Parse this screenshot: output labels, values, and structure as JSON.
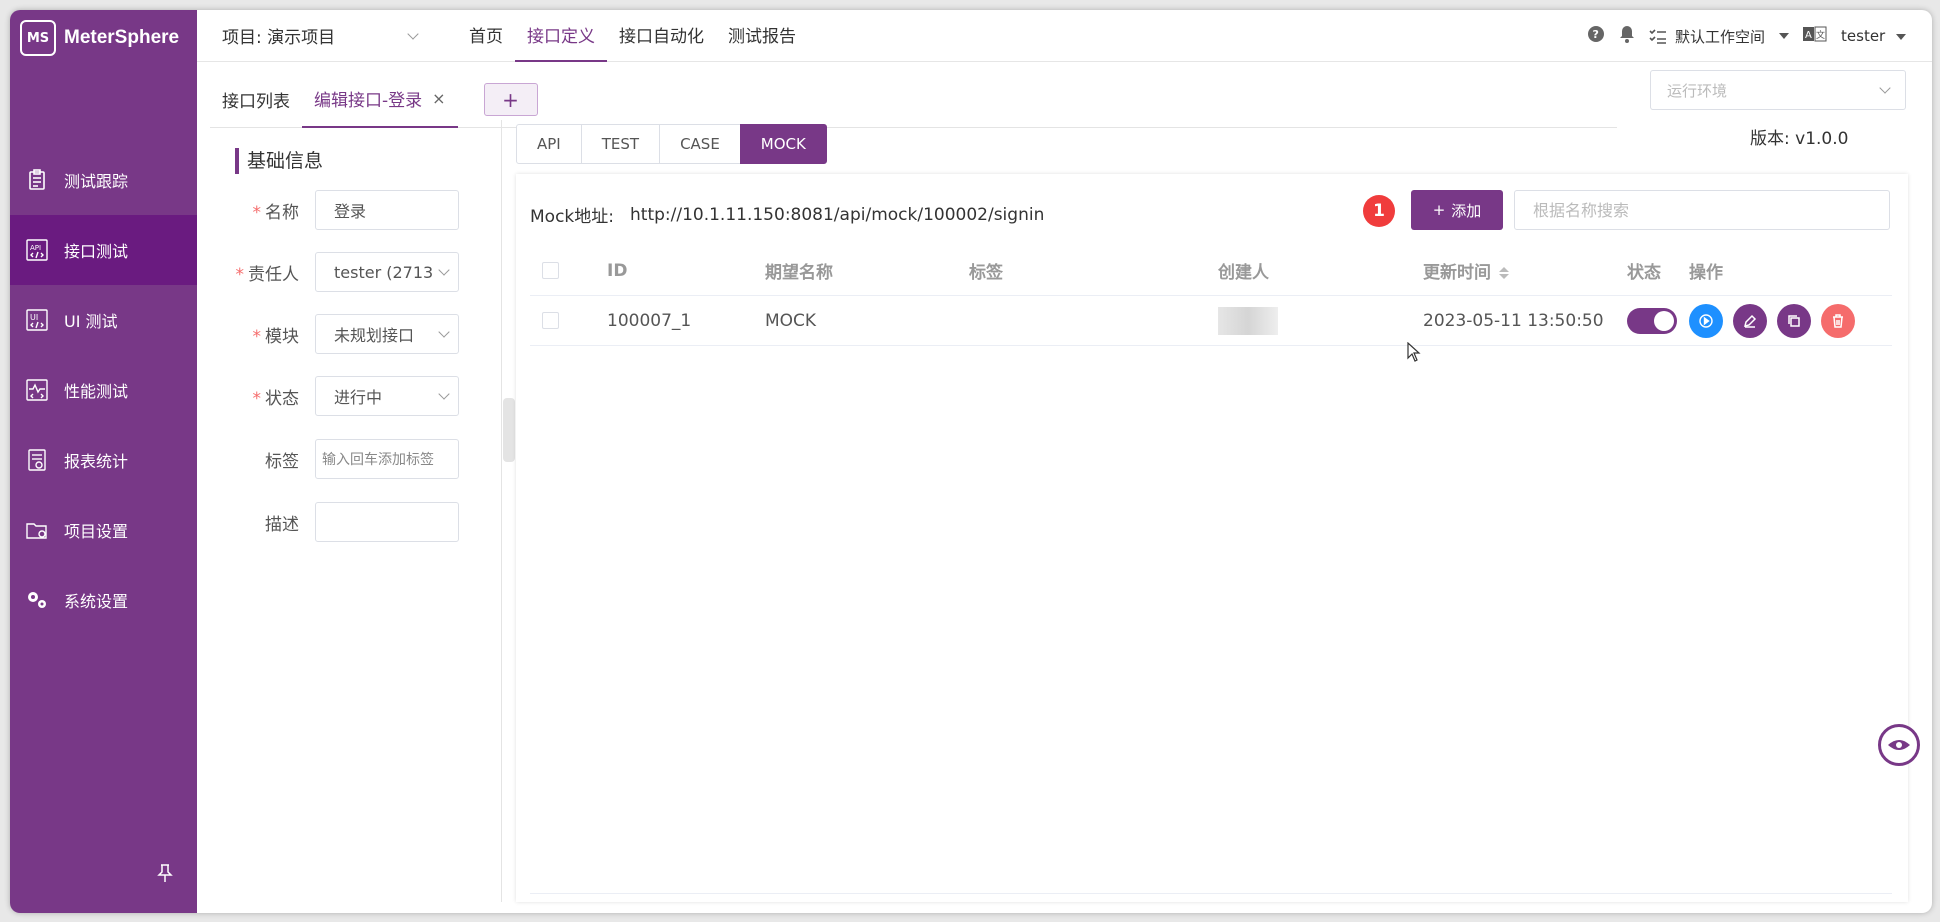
{
  "app": {
    "name": "MeterSphere",
    "logo_mark": "MS"
  },
  "sidebar": {
    "items": [
      {
        "label": "测试跟踪",
        "icon": "clipboard-icon"
      },
      {
        "label": "接口测试",
        "icon": "api-icon",
        "active": true
      },
      {
        "label": "UI 测试",
        "icon": "ui-icon"
      },
      {
        "label": "性能测试",
        "icon": "performance-icon"
      },
      {
        "label": "报表统计",
        "icon": "report-icon"
      },
      {
        "label": "项目设置",
        "icon": "folder-settings-icon"
      },
      {
        "label": "系统设置",
        "icon": "gears-icon"
      }
    ],
    "pin_icon": "pin-icon"
  },
  "header": {
    "project": "项目: 演示项目",
    "menu": [
      "首页",
      "接口定义",
      "接口自动化",
      "测试报告"
    ],
    "active_menu": "接口定义",
    "workspace": "默认工作空间",
    "user": "tester"
  },
  "tabs": {
    "list": "接口列表",
    "edit": "编辑接口-登录",
    "close": "×",
    "add": "+"
  },
  "env_select": {
    "placeholder": "运行环境"
  },
  "version": "版本: v1.0.0",
  "basic_info": {
    "title": "基础信息",
    "name_label": "名称",
    "name_value": "登录",
    "owner_label": "责任人",
    "owner_value": "tester (2713",
    "module_label": "模块",
    "module_value": "未规划接口",
    "status_label": "状态",
    "status_value": "进行中",
    "tag_label": "标签",
    "tag_placeholder": "输入回车添加标签",
    "desc_label": "描述",
    "required_mark": "*"
  },
  "type_tabs": [
    "API",
    "TEST",
    "CASE",
    "MOCK"
  ],
  "active_type_tab": "MOCK",
  "mock": {
    "url_label": "Mock地址:",
    "url": "http://10.1.11.150:8081/api/mock/100002/signin",
    "badge": "1",
    "add_label": "添加",
    "search_placeholder": "根据名称搜索",
    "columns": [
      "ID",
      "期望名称",
      "标签",
      "创建人",
      "更新时间",
      "状态",
      "操作"
    ],
    "rows": [
      {
        "id": "100007_1",
        "name": "MOCK",
        "tags": "",
        "creator": "",
        "updated": "2023-05-11 13:50:50",
        "enabled": true
      }
    ]
  },
  "colors": {
    "brand": "#783887",
    "run": "#1e90ff",
    "danger": "#f56c6c",
    "badge": "#f03c3c"
  }
}
